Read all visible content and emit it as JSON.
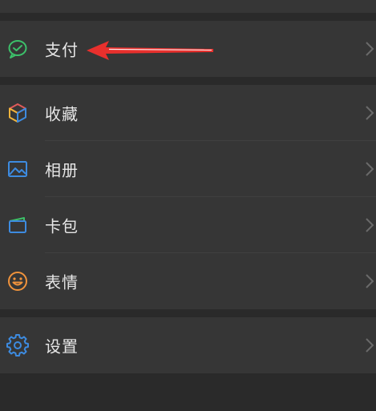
{
  "menu": {
    "pay": {
      "label": "支付",
      "icon": "wechat-pay-icon",
      "color": "#3cc06a"
    },
    "favorites": {
      "label": "收藏",
      "icon": "cube-icon"
    },
    "album": {
      "label": "相册",
      "icon": "image-icon",
      "color": "#3d8be0"
    },
    "cards": {
      "label": "卡包",
      "icon": "wallet-icon",
      "color": "#3d8be0"
    },
    "stickers": {
      "label": "表情",
      "icon": "smiley-icon",
      "color": "#f0933c"
    },
    "settings": {
      "label": "设置",
      "icon": "gear-icon",
      "color": "#3d8be0"
    }
  },
  "annotation": {
    "icon": "red-arrow-icon",
    "color": "#e8302d"
  }
}
